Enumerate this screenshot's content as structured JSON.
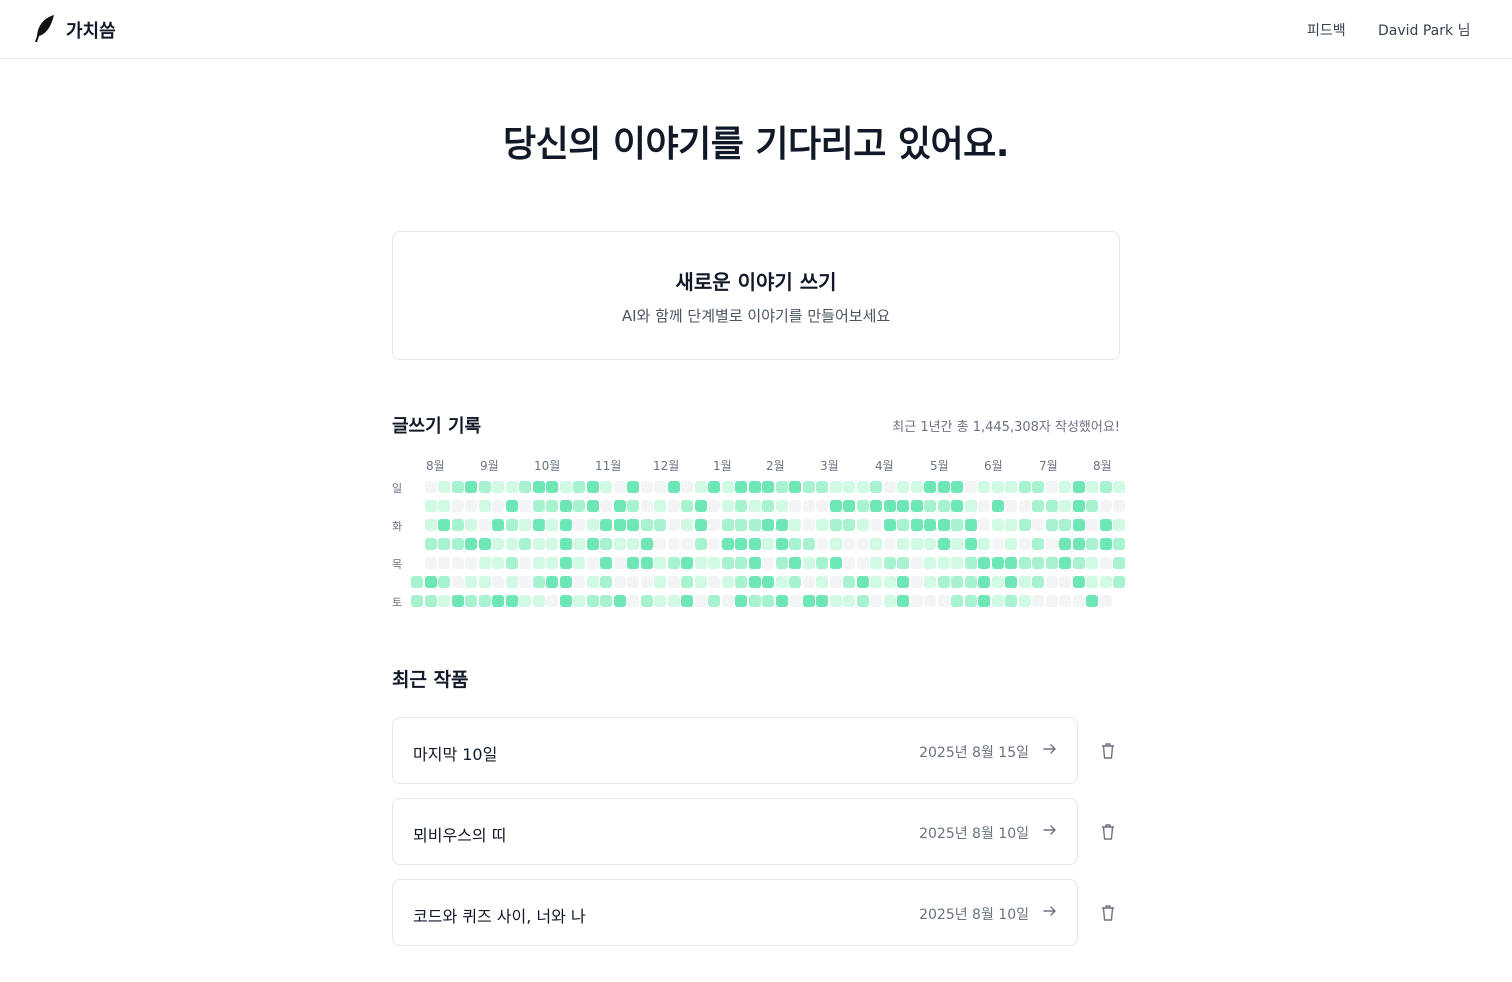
{
  "header": {
    "brand": "가치씀",
    "feedback": "피드백",
    "user": "David Park 님"
  },
  "hero": {
    "title": "당신의 이야기를 기다리고 있어요."
  },
  "new_story": {
    "title": "새로운 이야기 쓰기",
    "subtitle": "AI와 함께 단계별로 이야기를 만들어보세요"
  },
  "records": {
    "title": "글쓰기 기록",
    "summary": "최근 1년간 총 1,445,308자 작성했어요!",
    "months": [
      "8월",
      "9월",
      "10월",
      "11월",
      "12월",
      "1월",
      "2월",
      "3월",
      "4월",
      "5월",
      "6월",
      "7월",
      "8월"
    ],
    "day_labels": [
      "일",
      "화",
      "목",
      "토"
    ],
    "week_count": 53,
    "level_colors": [
      "#f3f4f6",
      "#d1fae5",
      "#a7f3d0",
      "#6ee7b7"
    ]
  },
  "works": {
    "title": "최근 작품",
    "items": [
      {
        "title": "마지막 10일",
        "date": "2025년 8월 15일"
      },
      {
        "title": "뫼비우스의 띠",
        "date": "2025년 8월 10일"
      },
      {
        "title": "코드와 퀴즈 사이, 너와 나",
        "date": "2025년 8월 10일"
      }
    ]
  }
}
